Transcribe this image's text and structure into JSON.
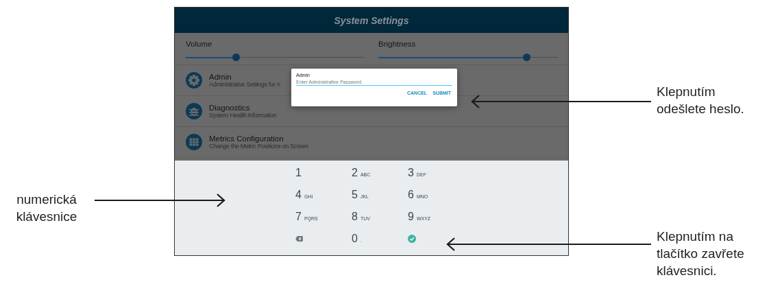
{
  "window": {
    "title": "System Settings"
  },
  "sliders": [
    {
      "label": "Volume",
      "level": 0.28
    },
    {
      "label": "Brightness",
      "level": 0.83
    }
  ],
  "menu_items": [
    {
      "kind": "gear",
      "title": "Admin",
      "subtitle": "Administrative Settings for A"
    },
    {
      "kind": "bug",
      "title": "Diagnostics",
      "subtitle": "System Health Information"
    },
    {
      "kind": "grid",
      "title": "Metrics Configuration",
      "subtitle": "Change the Metric Positions on Screen"
    }
  ],
  "dialog": {
    "title": "Admin",
    "placeholder": "Enter Administrative Password:",
    "buttons": [
      "CANCEL",
      "SUBMIT"
    ]
  },
  "keypad": [
    {
      "kind": "digit",
      "digit": "1"
    },
    {
      "kind": "digit",
      "digit": "2",
      "letters": "ABC"
    },
    {
      "kind": "digit",
      "digit": "3",
      "letters": "DEF"
    },
    {
      "kind": "digit",
      "digit": "4",
      "letters": "GHI"
    },
    {
      "kind": "digit",
      "digit": "5",
      "letters": "JKL"
    },
    {
      "kind": "digit",
      "digit": "6",
      "letters": "MNO"
    },
    {
      "kind": "digit",
      "digit": "7",
      "letters": "PQRS"
    },
    {
      "kind": "digit",
      "digit": "8",
      "letters": "TUV"
    },
    {
      "kind": "digit",
      "digit": "9",
      "letters": "WXYZ"
    },
    {
      "kind": "backspace"
    },
    {
      "kind": "digit",
      "digit": "0",
      "letters": "."
    },
    {
      "kind": "done"
    }
  ],
  "callouts": [
    {
      "text": "numerická\nklávesnice"
    },
    {
      "text": "Klepnutím\nodešlete heslo."
    },
    {
      "text": "Klepnutím na\ntlačítko zavřete\nklávesnici."
    }
  ]
}
